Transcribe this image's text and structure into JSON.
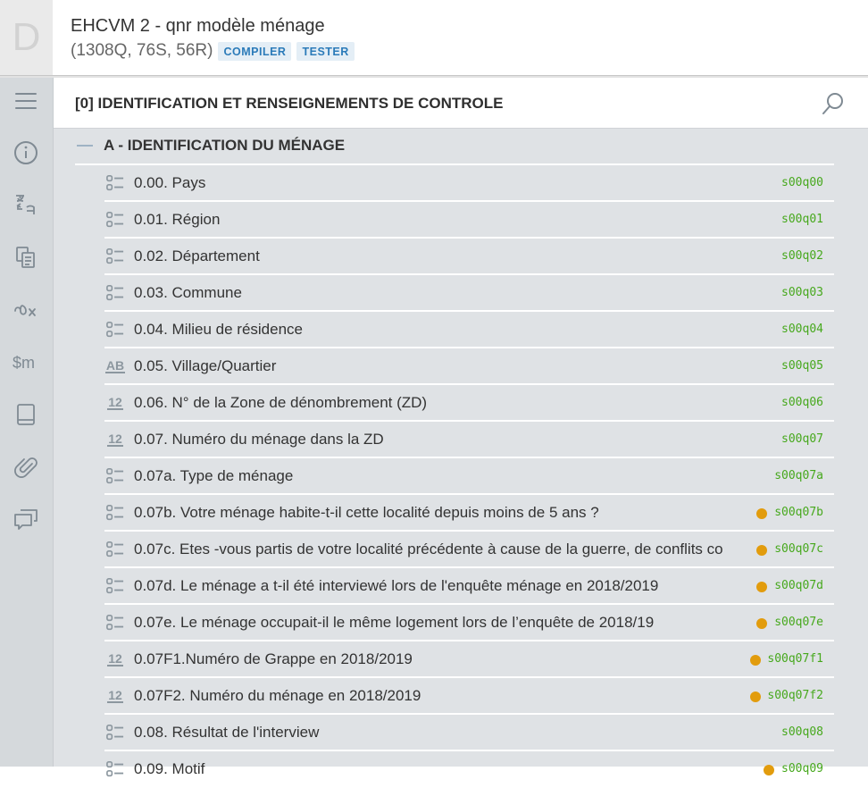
{
  "header": {
    "logo_letter": "D",
    "title": "EHCVM 2 - qnr modèle ménage",
    "stats": "(1308Q, 76S, 56R)",
    "compile_label": "COMPILER",
    "test_label": "TESTER"
  },
  "sidebar": {
    "items": [
      {
        "icon": "hamburger-menu-icon"
      },
      {
        "icon": "info-icon"
      },
      {
        "icon": "translation-icon"
      },
      {
        "icon": "copy-documents-icon"
      },
      {
        "icon": "variables-icon"
      },
      {
        "icon": "macros-icon"
      },
      {
        "icon": "lookup-book-icon"
      },
      {
        "icon": "attachment-icon"
      },
      {
        "icon": "comments-icon"
      }
    ]
  },
  "section": {
    "title": "[0] IDENTIFICATION ET RENSEIGNEMENTS DE CONTROLE"
  },
  "group": {
    "title": "A - IDENTIFICATION DU MÉNAGE"
  },
  "questions": [
    {
      "type": "list",
      "text": "0.00. Pays",
      "var": "s00q00",
      "flag": false
    },
    {
      "type": "list",
      "text": "0.01. Région",
      "var": "s00q01",
      "flag": false
    },
    {
      "type": "list",
      "text": "0.02. Département",
      "var": "s00q02",
      "flag": false
    },
    {
      "type": "list",
      "text": "0.03. Commune",
      "var": "s00q03",
      "flag": false
    },
    {
      "type": "list",
      "text": "0.04. Milieu de résidence",
      "var": "s00q04",
      "flag": false
    },
    {
      "type": "text",
      "text": "0.05. Village/Quartier",
      "var": "s00q05",
      "flag": false
    },
    {
      "type": "numeric",
      "text": "0.06. N° de la Zone de dénombrement (ZD)",
      "var": "s00q06",
      "flag": false
    },
    {
      "type": "numeric",
      "text": "0.07. Numéro du ménage dans la ZD",
      "var": "s00q07",
      "flag": false
    },
    {
      "type": "list",
      "text": "0.07a. Type de ménage",
      "var": "s00q07a",
      "flag": false
    },
    {
      "type": "list",
      "text": "0.07b. Votre ménage habite-t-il cette localité depuis moins de 5 ans ?",
      "var": "s00q07b",
      "flag": true
    },
    {
      "type": "list",
      "text": "0.07c. Etes -vous partis de votre localité précédente à cause de la guerre, de conflits co",
      "var": "s00q07c",
      "flag": true
    },
    {
      "type": "list",
      "text": "0.07d. Le ménage a t-il été interviewé lors de l'enquête ménage en 2018/2019",
      "var": "s00q07d",
      "flag": true
    },
    {
      "type": "list",
      "text": "0.07e. Le ménage occupait-il le même logement lors de l’enquête de 2018/19",
      "var": "s00q07e",
      "flag": true
    },
    {
      "type": "numeric",
      "text": "0.07F1.Numéro de Grappe en 2018/2019",
      "var": "s00q07f1",
      "flag": true
    },
    {
      "type": "numeric",
      "text": "0.07F2. Numéro du ménage en 2018/2019",
      "var": "s00q07f2",
      "flag": true
    },
    {
      "type": "list",
      "text": "0.08. Résultat de l'interview",
      "var": "s00q08",
      "flag": false
    },
    {
      "type": "list",
      "text": "0.09. Motif",
      "var": "s00q09",
      "flag": true
    }
  ],
  "icon_labels": {
    "numeric": "12",
    "text": "AB"
  },
  "colors": {
    "varname": "#46a81c",
    "flag_dot": "#e29c0d",
    "tag_text": "#2b7bb9",
    "sidebar_bg": "#d5d9dc",
    "main_bg": "#dfe2e5"
  }
}
